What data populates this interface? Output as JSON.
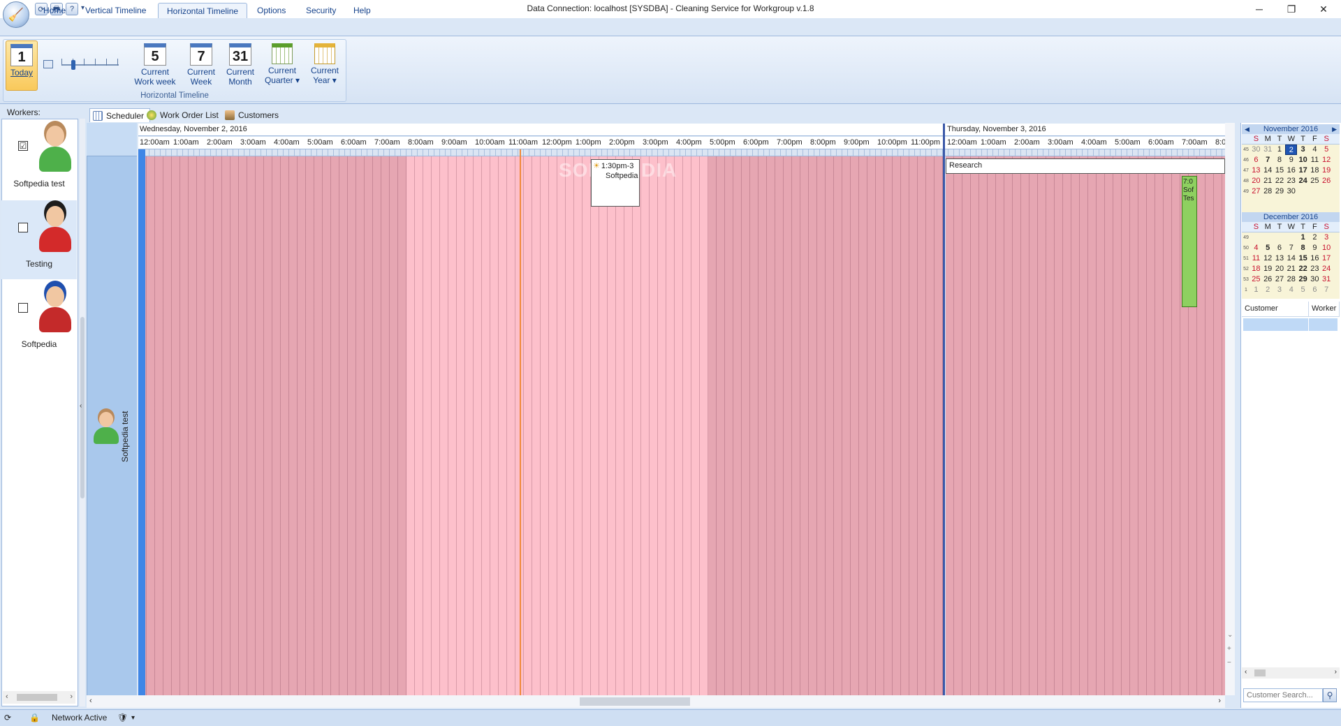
{
  "window": {
    "title": "Data Connection: localhost [SYSDBA] - Cleaning Service for Workgroup v.1.8"
  },
  "ribbon": {
    "tabs": [
      {
        "label": "Home"
      },
      {
        "label": "Vertical Timeline"
      },
      {
        "label": "Horizontal Timeline"
      },
      {
        "label": "Options"
      },
      {
        "label": "Security"
      },
      {
        "label": "Help"
      }
    ],
    "active_tab": "Horizontal Timeline",
    "group_label": "Horizontal Timeline",
    "buttons": {
      "today": {
        "icon_text": "1",
        "label": "Today"
      },
      "work_week": {
        "icon_text": "5",
        "line1": "Current",
        "line2": "Work week"
      },
      "week": {
        "icon_text": "7",
        "line1": "Current",
        "line2": "Week"
      },
      "month": {
        "icon_text": "31",
        "line1": "Current",
        "line2": "Month"
      },
      "quarter": {
        "line1": "Current",
        "line2": "Quarter ▾"
      },
      "year": {
        "line1": "Current",
        "line2": "Year ▾"
      }
    }
  },
  "workers": {
    "header": "Workers:",
    "items": [
      {
        "name": "Softpedia test",
        "checked": "☑"
      },
      {
        "name": "Testing",
        "checked": ""
      },
      {
        "name": "Softpedia",
        "checked": ""
      }
    ]
  },
  "scheduler_tabs": [
    {
      "label": "Scheduler"
    },
    {
      "label": "Work Order List"
    },
    {
      "label": "Customers"
    }
  ],
  "resource": {
    "name": "Softpedia test"
  },
  "timeline": {
    "day1": {
      "date": "Wednesday, November 2, 2016",
      "hours": [
        "12:00am",
        "1:00am",
        "2:00am",
        "3:00am",
        "4:00am",
        "5:00am",
        "6:00am",
        "7:00am",
        "8:00am",
        "9:00am",
        "10:00am",
        "11:00am",
        "12:00pm",
        "1:00pm",
        "2:00pm",
        "3:00pm",
        "4:00pm",
        "5:00pm",
        "6:00pm",
        "7:00pm",
        "8:00pm",
        "9:00pm",
        "10:00pm",
        "11:00pm"
      ]
    },
    "day2": {
      "date": "Thursday, November 3, 2016",
      "hours": [
        "12:00am",
        "1:00am",
        "2:00am",
        "3:00am",
        "4:00am",
        "5:00am",
        "6:00am",
        "7:00am",
        "8:0"
      ]
    },
    "appointments": [
      {
        "time": "1:30pm-3",
        "title": "Softpedia"
      },
      {
        "time": "7:0",
        "title": "Sof",
        "extra": "Tes"
      }
    ],
    "research_label": "Research",
    "watermark": "SOFTPEDIA",
    "colors": {
      "work_hours": "#fdc0cb",
      "off_hours": "#e6a6b2",
      "today_bar": "#3f86e6",
      "now_line": "#f08a3a"
    }
  },
  "calendar": {
    "november": {
      "title": "November 2016",
      "dow": [
        "S",
        "M",
        "T",
        "W",
        "T",
        "F",
        "S"
      ],
      "weeks": [
        {
          "wk": "45",
          "days": [
            "30",
            "31",
            "1",
            "2",
            "3",
            "4",
            "5"
          ]
        },
        {
          "wk": "46",
          "days": [
            "6",
            "7",
            "8",
            "9",
            "10",
            "11",
            "12"
          ]
        },
        {
          "wk": "47",
          "days": [
            "13",
            "14",
            "15",
            "16",
            "17",
            "18",
            "19"
          ]
        },
        {
          "wk": "48",
          "days": [
            "20",
            "21",
            "22",
            "23",
            "24",
            "25",
            "26"
          ]
        },
        {
          "wk": "49",
          "days": [
            "27",
            "28",
            "29",
            "30",
            "",
            "",
            ""
          ]
        }
      ]
    },
    "december": {
      "title": "December 2016",
      "dow": [
        "S",
        "M",
        "T",
        "W",
        "T",
        "F",
        "S"
      ],
      "weeks": [
        {
          "wk": "49",
          "days": [
            "",
            "",
            "",
            "",
            "1",
            "2",
            "3"
          ]
        },
        {
          "wk": "50",
          "days": [
            "4",
            "5",
            "6",
            "7",
            "8",
            "9",
            "10"
          ]
        },
        {
          "wk": "51",
          "days": [
            "11",
            "12",
            "13",
            "14",
            "15",
            "16",
            "17"
          ]
        },
        {
          "wk": "52",
          "days": [
            "18",
            "19",
            "20",
            "21",
            "22",
            "23",
            "24"
          ]
        },
        {
          "wk": "53",
          "days": [
            "25",
            "26",
            "27",
            "28",
            "29",
            "30",
            "31"
          ]
        },
        {
          "wk": "1",
          "days": [
            "1",
            "2",
            "3",
            "4",
            "5",
            "6",
            "7"
          ]
        }
      ]
    }
  },
  "customer_grid": {
    "columns": [
      "Customer",
      "Worker"
    ],
    "search_placeholder": "Customer Search..."
  },
  "statusbar": {
    "network": "Network Active"
  }
}
